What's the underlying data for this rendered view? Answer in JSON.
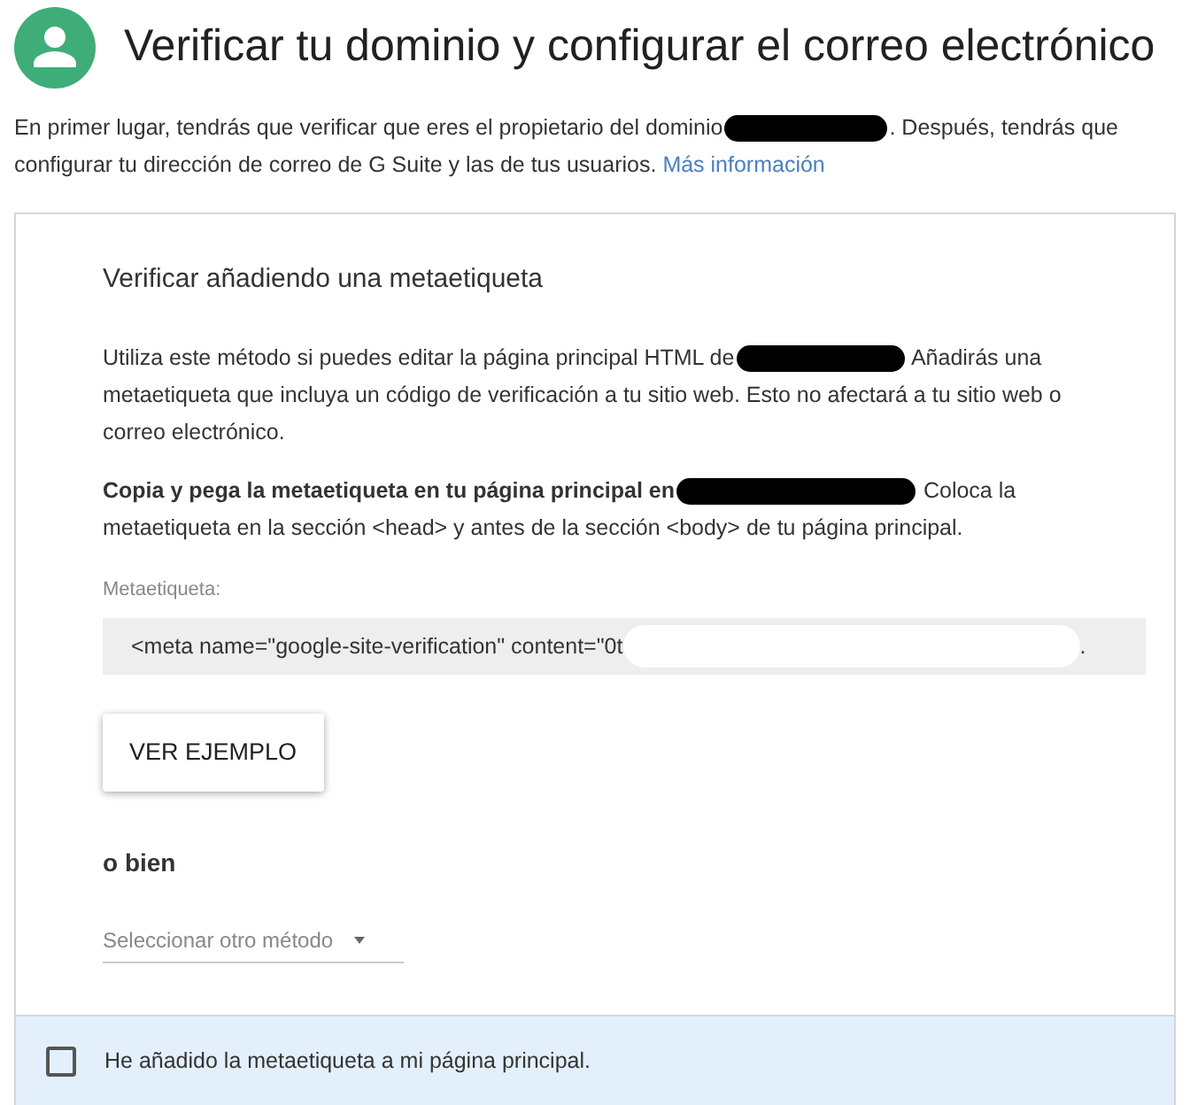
{
  "header": {
    "title": "Verificar tu dominio y configurar el correo electrónico"
  },
  "intro": {
    "before": "En primer lugar, tendrás que verificar que eres el propietario del dominio",
    "after": ". Después, tendrás que",
    "line_2": "configurar tu dirección de correo de G Suite y las de tus usuarios.",
    "link": "Más información"
  },
  "card": {
    "title": "Verificar añadiendo una metaetiqueta",
    "paragraphs": [
      {
        "bold": false,
        "before": "Utiliza este método si puedes editar la página principal HTML de",
        "after": " Añadirás una",
        "lines": [
          "metaetiqueta que incluya un código de verificación a tu sitio web. Esto no afectará a tu sitio web o",
          "correo electrónico."
        ]
      },
      {
        "bold": true,
        "before": "Copia y pega la metaetiqueta en tu página principal en",
        "after": " Coloca la",
        "lines": [
          "metaetiqueta en la sección <head> y antes de la sección <body> de tu página principal."
        ]
      }
    ],
    "field_label": "Metaetiqueta:",
    "meta_start": "<meta name=\"google-site-verification\" content=\"0t",
    "meta_end": ".",
    "button": "VER EJEMPLO",
    "alt_heading": "o bien",
    "select": {
      "placeholder": "Seleccionar otro método"
    }
  },
  "confirm": {
    "label": "He añadido la metaetiqueta a mi página principal.",
    "checked": false
  }
}
